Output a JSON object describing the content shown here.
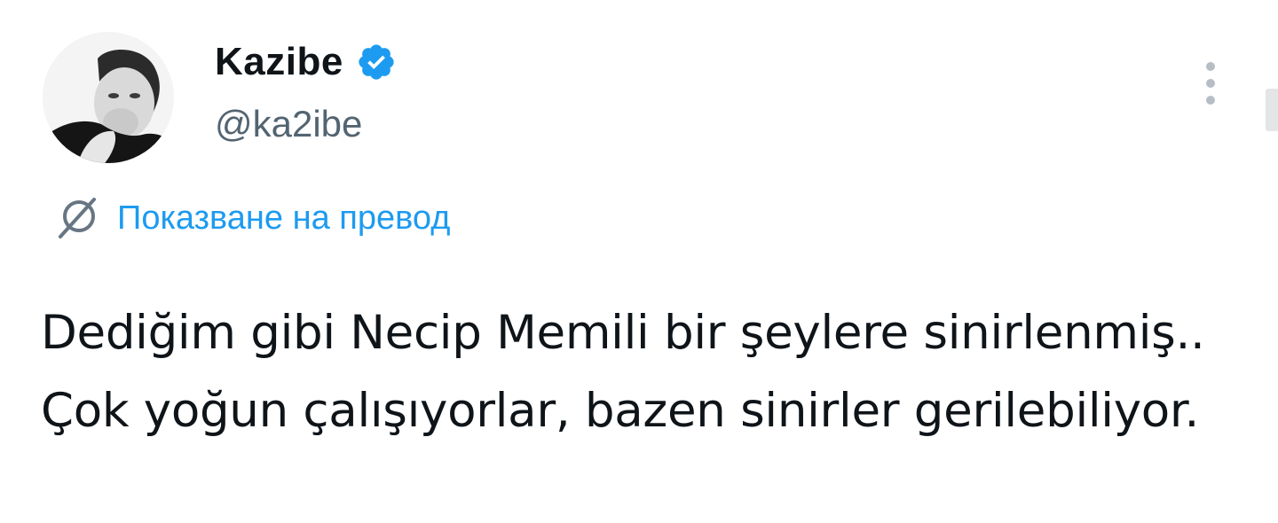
{
  "author": {
    "display_name": "Kazibe",
    "handle": "@ka2ibe",
    "verified": true,
    "avatar_icon": "profile-photo"
  },
  "menu": {
    "more_icon": "vertical-dots-icon"
  },
  "translate": {
    "icon": "globe-icon",
    "label": "Показване на превод"
  },
  "tweet": {
    "text": "Dediğim gibi Necip Memili bir şeylere sinirlenmiş.. Çok yoğun çalışıyorlar, bazen sinirler gerilebiliyor."
  },
  "colors": {
    "link": "#1d9bf0",
    "verified": "#1d9bf0",
    "secondary_text": "#536471",
    "primary_text": "#0f1419",
    "icon_gray": "#b6bec5"
  }
}
